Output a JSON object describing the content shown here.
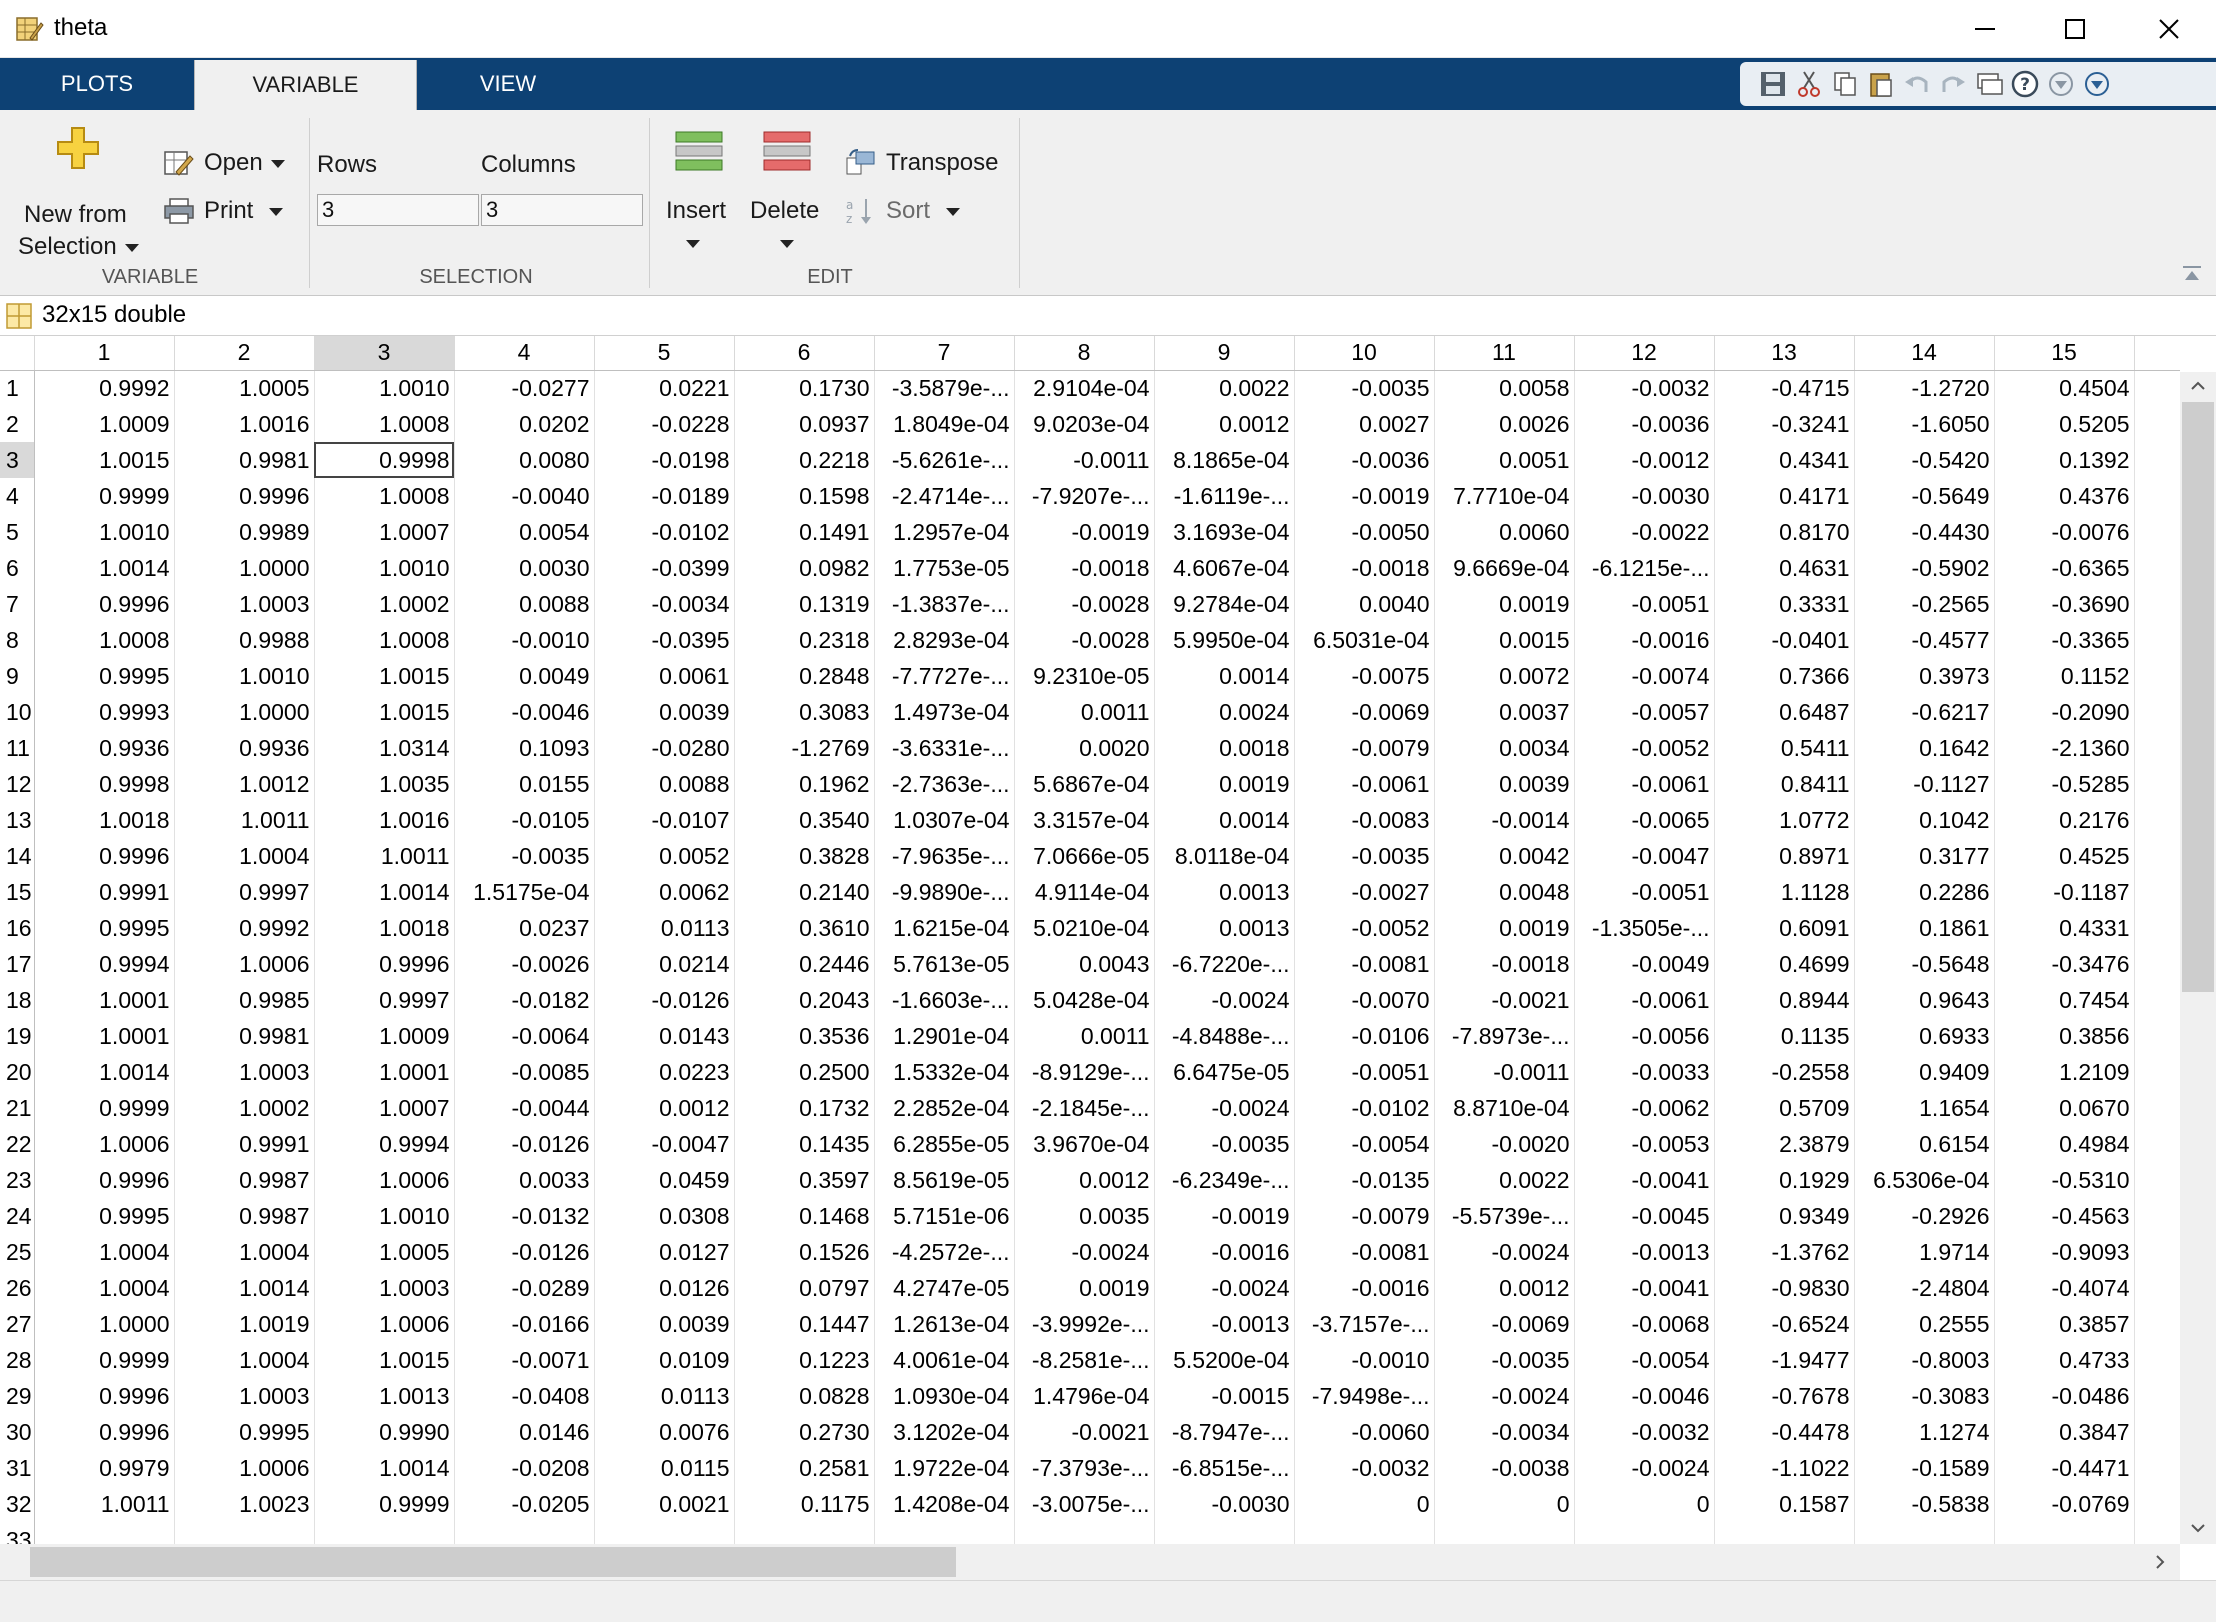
{
  "window": {
    "title": "theta"
  },
  "tabs": [
    {
      "label": "PLOTS"
    },
    {
      "label": "VARIABLE"
    },
    {
      "label": "VIEW"
    }
  ],
  "ribbon": {
    "variable_section": {
      "label": "VARIABLE",
      "new_from_selection_line1": "New from",
      "new_from_selection_line2": "Selection",
      "open_label": "Open",
      "print_label": "Print"
    },
    "selection_section": {
      "label": "SELECTION",
      "rows_label": "Rows",
      "columns_label": "Columns",
      "rows_value": "3",
      "columns_value": "3"
    },
    "edit_section": {
      "label": "EDIT",
      "insert_label": "Insert",
      "delete_label": "Delete",
      "transpose_label": "Transpose",
      "sort_label": "Sort"
    }
  },
  "variable_info": "32x15 double",
  "grid": {
    "columns": [
      "1",
      "2",
      "3",
      "4",
      "5",
      "6",
      "7",
      "8",
      "9",
      "10",
      "11",
      "12",
      "13",
      "14",
      "15"
    ],
    "selected_row": 3,
    "selected_col": 3,
    "partial_row_label": "33",
    "rows": [
      [
        "0.9992",
        "1.0005",
        "1.0010",
        "-0.0277",
        "0.0221",
        "0.1730",
        "-3.5879e-...",
        "2.9104e-04",
        "0.0022",
        "-0.0035",
        "0.0058",
        "-0.0032",
        "-0.4715",
        "-1.2720",
        "0.4504"
      ],
      [
        "1.0009",
        "1.0016",
        "1.0008",
        "0.0202",
        "-0.0228",
        "0.0937",
        "1.8049e-04",
        "9.0203e-04",
        "0.0012",
        "0.0027",
        "0.0026",
        "-0.0036",
        "-0.3241",
        "-1.6050",
        "0.5205"
      ],
      [
        "1.0015",
        "0.9981",
        "0.9998",
        "0.0080",
        "-0.0198",
        "0.2218",
        "-5.6261e-...",
        "-0.0011",
        "8.1865e-04",
        "-0.0036",
        "0.0051",
        "-0.0012",
        "0.4341",
        "-0.5420",
        "0.1392"
      ],
      [
        "0.9999",
        "0.9996",
        "1.0008",
        "-0.0040",
        "-0.0189",
        "0.1598",
        "-2.4714e-...",
        "-7.9207e-...",
        "-1.6119e-...",
        "-0.0019",
        "7.7710e-04",
        "-0.0030",
        "0.4171",
        "-0.5649",
        "0.4376"
      ],
      [
        "1.0010",
        "0.9989",
        "1.0007",
        "0.0054",
        "-0.0102",
        "0.1491",
        "1.2957e-04",
        "-0.0019",
        "3.1693e-04",
        "-0.0050",
        "0.0060",
        "-0.0022",
        "0.8170",
        "-0.4430",
        "-0.0076"
      ],
      [
        "1.0014",
        "1.0000",
        "1.0010",
        "0.0030",
        "-0.0399",
        "0.0982",
        "1.7753e-05",
        "-0.0018",
        "4.6067e-04",
        "-0.0018",
        "9.6669e-04",
        "-6.1215e-...",
        "0.4631",
        "-0.5902",
        "-0.6365"
      ],
      [
        "0.9996",
        "1.0003",
        "1.0002",
        "0.0088",
        "-0.0034",
        "0.1319",
        "-1.3837e-...",
        "-0.0028",
        "9.2784e-04",
        "0.0040",
        "0.0019",
        "-0.0051",
        "0.3331",
        "-0.2565",
        "-0.3690"
      ],
      [
        "1.0008",
        "0.9988",
        "1.0008",
        "-0.0010",
        "-0.0395",
        "0.2318",
        "2.8293e-04",
        "-0.0028",
        "5.9950e-04",
        "6.5031e-04",
        "0.0015",
        "-0.0016",
        "-0.0401",
        "-0.4577",
        "-0.3365"
      ],
      [
        "0.9995",
        "1.0010",
        "1.0015",
        "0.0049",
        "0.0061",
        "0.2848",
        "-7.7727e-...",
        "9.2310e-05",
        "0.0014",
        "-0.0075",
        "0.0072",
        "-0.0074",
        "0.7366",
        "0.3973",
        "0.1152"
      ],
      [
        "0.9993",
        "1.0000",
        "1.0015",
        "-0.0046",
        "0.0039",
        "0.3083",
        "1.4973e-04",
        "0.0011",
        "0.0024",
        "-0.0069",
        "0.0037",
        "-0.0057",
        "0.6487",
        "-0.6217",
        "-0.2090"
      ],
      [
        "0.9936",
        "0.9936",
        "1.0314",
        "0.1093",
        "-0.0280",
        "-1.2769",
        "-3.6331e-...",
        "0.0020",
        "0.0018",
        "-0.0079",
        "0.0034",
        "-0.0052",
        "0.5411",
        "0.1642",
        "-2.1360"
      ],
      [
        "0.9998",
        "1.0012",
        "1.0035",
        "0.0155",
        "0.0088",
        "0.1962",
        "-2.7363e-...",
        "5.6867e-04",
        "0.0019",
        "-0.0061",
        "0.0039",
        "-0.0061",
        "0.8411",
        "-0.1127",
        "-0.5285"
      ],
      [
        "1.0018",
        "1.0011",
        "1.0016",
        "-0.0105",
        "-0.0107",
        "0.3540",
        "1.0307e-04",
        "3.3157e-04",
        "0.0014",
        "-0.0083",
        "-0.0014",
        "-0.0065",
        "1.0772",
        "0.1042",
        "0.2176"
      ],
      [
        "0.9996",
        "1.0004",
        "1.0011",
        "-0.0035",
        "0.0052",
        "0.3828",
        "-7.9635e-...",
        "7.0666e-05",
        "8.0118e-04",
        "-0.0035",
        "0.0042",
        "-0.0047",
        "0.8971",
        "0.3177",
        "0.4525"
      ],
      [
        "0.9991",
        "0.9997",
        "1.0014",
        "1.5175e-04",
        "0.0062",
        "0.2140",
        "-9.9890e-...",
        "4.9114e-04",
        "0.0013",
        "-0.0027",
        "0.0048",
        "-0.0051",
        "1.1128",
        "0.2286",
        "-0.1187"
      ],
      [
        "0.9995",
        "0.9992",
        "1.0018",
        "0.0237",
        "0.0113",
        "0.3610",
        "1.6215e-04",
        "5.0210e-04",
        "0.0013",
        "-0.0052",
        "0.0019",
        "-1.3505e-...",
        "0.6091",
        "0.1861",
        "0.4331"
      ],
      [
        "0.9994",
        "1.0006",
        "0.9996",
        "-0.0026",
        "0.0214",
        "0.2446",
        "5.7613e-05",
        "0.0043",
        "-6.7220e-...",
        "-0.0081",
        "-0.0018",
        "-0.0049",
        "0.4699",
        "-0.5648",
        "-0.3476"
      ],
      [
        "1.0001",
        "0.9985",
        "0.9997",
        "-0.0182",
        "-0.0126",
        "0.2043",
        "-1.6603e-...",
        "5.0428e-04",
        "-0.0024",
        "-0.0070",
        "-0.0021",
        "-0.0061",
        "0.8944",
        "0.9643",
        "0.7454"
      ],
      [
        "1.0001",
        "0.9981",
        "1.0009",
        "-0.0064",
        "0.0143",
        "0.3536",
        "1.2901e-04",
        "0.0011",
        "-4.8488e-...",
        "-0.0106",
        "-7.8973e-...",
        "-0.0056",
        "0.1135",
        "0.6933",
        "0.3856"
      ],
      [
        "1.0014",
        "1.0003",
        "1.0001",
        "-0.0085",
        "0.0223",
        "0.2500",
        "1.5332e-04",
        "-8.9129e-...",
        "6.6475e-05",
        "-0.0051",
        "-0.0011",
        "-0.0033",
        "-0.2558",
        "0.9409",
        "1.2109"
      ],
      [
        "0.9999",
        "1.0002",
        "1.0007",
        "-0.0044",
        "0.0012",
        "0.1732",
        "2.2852e-04",
        "-2.1845e-...",
        "-0.0024",
        "-0.0102",
        "8.8710e-04",
        "-0.0062",
        "0.5709",
        "1.1654",
        "0.0670"
      ],
      [
        "1.0006",
        "0.9991",
        "0.9994",
        "-0.0126",
        "-0.0047",
        "0.1435",
        "6.2855e-05",
        "3.9670e-04",
        "-0.0035",
        "-0.0054",
        "-0.0020",
        "-0.0053",
        "2.3879",
        "0.6154",
        "0.4984"
      ],
      [
        "0.9996",
        "0.9987",
        "1.0006",
        "0.0033",
        "0.0459",
        "0.3597",
        "8.5619e-05",
        "0.0012",
        "-6.2349e-...",
        "-0.0135",
        "0.0022",
        "-0.0041",
        "0.1929",
        "6.5306e-04",
        "-0.5310"
      ],
      [
        "0.9995",
        "0.9987",
        "1.0010",
        "-0.0132",
        "0.0308",
        "0.1468",
        "5.7151e-06",
        "0.0035",
        "-0.0019",
        "-0.0079",
        "-5.5739e-...",
        "-0.0045",
        "0.9349",
        "-0.2926",
        "-0.4563"
      ],
      [
        "1.0004",
        "1.0004",
        "1.0005",
        "-0.0126",
        "0.0127",
        "0.1526",
        "-4.2572e-...",
        "-0.0024",
        "-0.0016",
        "-0.0081",
        "-0.0024",
        "-0.0013",
        "-1.3762",
        "1.9714",
        "-0.9093"
      ],
      [
        "1.0004",
        "1.0014",
        "1.0003",
        "-0.0289",
        "0.0126",
        "0.0797",
        "4.2747e-05",
        "0.0019",
        "-0.0024",
        "-0.0016",
        "0.0012",
        "-0.0041",
        "-0.9830",
        "-2.4804",
        "-0.4074"
      ],
      [
        "1.0000",
        "1.0019",
        "1.0006",
        "-0.0166",
        "0.0039",
        "0.1447",
        "1.2613e-04",
        "-3.9992e-...",
        "-0.0013",
        "-3.7157e-...",
        "-0.0069",
        "-0.0068",
        "-0.6524",
        "0.2555",
        "0.3857"
      ],
      [
        "0.9999",
        "1.0004",
        "1.0015",
        "-0.0071",
        "0.0109",
        "0.1223",
        "4.0061e-04",
        "-8.2581e-...",
        "5.5200e-04",
        "-0.0010",
        "-0.0035",
        "-0.0054",
        "-1.9477",
        "-0.8003",
        "0.4733"
      ],
      [
        "0.9996",
        "1.0003",
        "1.0013",
        "-0.0408",
        "0.0113",
        "0.0828",
        "1.0930e-04",
        "1.4796e-04",
        "-0.0015",
        "-7.9498e-...",
        "-0.0024",
        "-0.0046",
        "-0.7678",
        "-0.3083",
        "-0.0486"
      ],
      [
        "0.9996",
        "0.9995",
        "0.9990",
        "0.0146",
        "0.0076",
        "0.2730",
        "3.1202e-04",
        "-0.0021",
        "-8.7947e-...",
        "-0.0060",
        "-0.0034",
        "-0.0032",
        "-0.4478",
        "1.1274",
        "0.3847"
      ],
      [
        "0.9979",
        "1.0006",
        "1.0014",
        "-0.0208",
        "0.0115",
        "0.2581",
        "1.9722e-04",
        "-7.3793e-...",
        "-6.8515e-...",
        "-0.0032",
        "-0.0038",
        "-0.0024",
        "-1.1022",
        "-0.1589",
        "-0.4471"
      ],
      [
        "1.0011",
        "1.0023",
        "0.9999",
        "-0.0205",
        "0.0021",
        "0.1175",
        "1.4208e-04",
        "-3.0075e-...",
        "-0.0030",
        "0",
        "0",
        "0",
        "0.1587",
        "-0.5838",
        "-0.0769"
      ]
    ]
  },
  "colors": {
    "tabstrip": "#0d4174",
    "ribbon_bg": "#f0f0f0",
    "selection_header": "#d9d9d9"
  }
}
